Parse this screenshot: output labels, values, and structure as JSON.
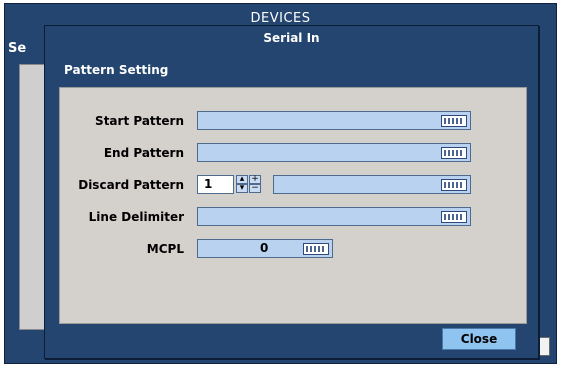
{
  "background_window": {
    "title": "DEVICES",
    "left_label": "Se"
  },
  "dialog": {
    "title": "Serial In",
    "section_title": "Pattern Setting",
    "fields": {
      "start_pattern": {
        "label": "Start Pattern",
        "value": ""
      },
      "end_pattern": {
        "label": "End Pattern",
        "value": ""
      },
      "discard_pattern": {
        "label": "Discard Pattern",
        "count": "1",
        "value": ""
      },
      "line_delimiter": {
        "label": "Line Delimiter",
        "value": ""
      },
      "mcpl": {
        "label": "MCPL",
        "value": "0"
      }
    },
    "close_label": "Close"
  },
  "icons": {
    "keyboard": "keyboard-icon",
    "spin_up": "spin-up-icon",
    "spin_down": "spin-down-icon",
    "increment": "plus-icon",
    "decrement": "minus-icon"
  },
  "colors": {
    "window_bg": "#23456f",
    "panel_bg": "#d4d0cc",
    "field_bg": "#b8d2ef",
    "button_bg": "#8fc3f0"
  }
}
